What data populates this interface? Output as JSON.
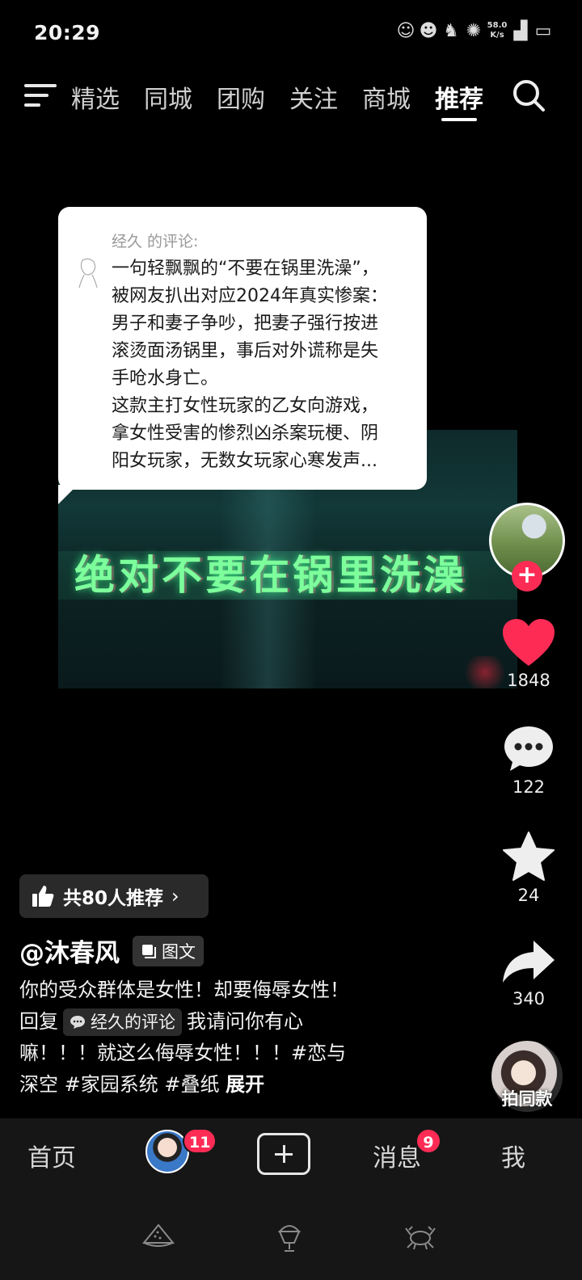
{
  "status_bar": {
    "time": "20:29",
    "net_speed": "58.0 K/s",
    "icons": [
      "cartoon-icon",
      "cartoon-icon",
      "cat-icon",
      "crab-icon",
      "signal-icon",
      "battery-icon"
    ]
  },
  "top_nav": {
    "tabs": [
      {
        "label": "精选",
        "visible": "精选"
      },
      {
        "label": "同城"
      },
      {
        "label": "团购"
      },
      {
        "label": "关注"
      },
      {
        "label": "商城"
      },
      {
        "label": "推荐",
        "active": true
      }
    ]
  },
  "comment_card": {
    "author_line": "经久 的评论:",
    "text": "一句轻飘飘的“不要在锅里洗澡”，\n被网友扒出对应2024年真实惨案：\n男子和妻子争吵，把妻子强行按进\n滚烫面汤锅里，事后对外谎称是失\n手呛水身亡。\n这款主打女性玩家的乙女向游戏，\n拿女性受害的惨烈凶杀案玩梗、阴\n阳女玩家，无数女玩家心寒发声..."
  },
  "video": {
    "overlay_text": "绝对不要在锅里洗澡"
  },
  "right_rail": {
    "likes": "1848",
    "comments": "122",
    "favorites": "24",
    "shares": "340",
    "music_label": "拍同款",
    "accent_color": "#fe2c55"
  },
  "post": {
    "recommend_label": "共80人推荐",
    "author": "@沐春风",
    "type_label": "图文",
    "desc_line1": "你的受众群体是女性！却要侮辱女性！",
    "desc_reply": "回复",
    "quote_label": "经久的评论",
    "desc_line2_rest": "我请问你有心",
    "desc_line3": "嘛！！！就这么侮辱女性！！！#恋与",
    "desc_line4": "深空 #家园系统 #叠纸",
    "expand": "展开"
  },
  "bottom_nav": {
    "home": "首页",
    "friends_badge": "11",
    "messages": "消息",
    "messages_badge": "9",
    "me": "我"
  }
}
